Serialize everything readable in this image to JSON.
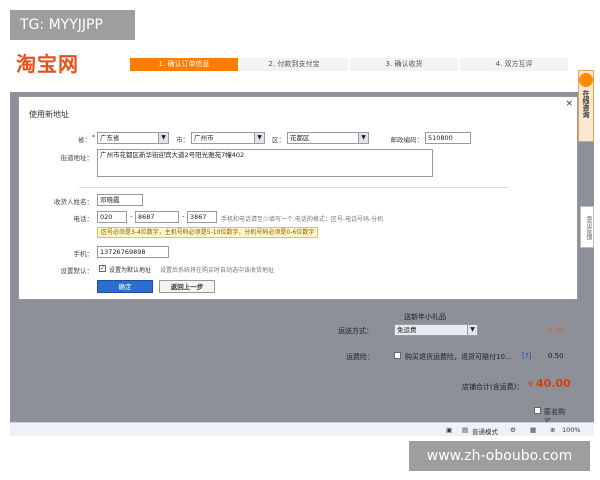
{
  "watermarks": {
    "top": "TG: MYYJJPP",
    "bottom": "www.zh-oboubo.com"
  },
  "header": {
    "logo": "淘宝网",
    "steps": [
      "1. 确认订单信息",
      "2. 付款到支付宝",
      "3. 确认收货",
      "4. 双方互评"
    ],
    "active_step": 0
  },
  "side": {
    "chat": "在线咨询",
    "feedback": "意见反馈"
  },
  "dialog": {
    "title": "使用新地址",
    "close": "×",
    "province_label": "省：",
    "province": "广东省",
    "city_label": "市：",
    "city": "广州市",
    "district_label": "区：",
    "district": "花都区",
    "postcode_label": "邮政编码：",
    "postcode": "510800",
    "street_label": "街道地址：",
    "street": "广州市花都区新华街迎宾大道2号阳光雅苑7幢402",
    "name_label": "收货人姓名：",
    "name": "邓晓霞",
    "phone_label": "电话：",
    "phone_area": "020",
    "phone_num": "8687",
    "phone_ext": "3867",
    "phone_hint": "手机和电话请至少填写一个,电话的格式：区号-电话号码-分机",
    "phone_warn": "区号必须是3-4位数字，主机号码必须是5-10位数字，分机号码必须是0-6位数字",
    "mobile_label": "手机：",
    "mobile": "13726769898",
    "default_label": "设置默认：",
    "default_check": "设置为默认地址",
    "default_hint": "设置后系统将在购买时自动选中该收货地址",
    "ok": "确定",
    "back": "返回上一步"
  },
  "order": {
    "gift_note": "送新年小礼品",
    "ship_label": "运送方式：",
    "ship_value": "免运费",
    "ship_price": "0.00",
    "insure_label": "运费险：",
    "insure_text": "购买退货运费险，退货可赔付10...",
    "insure_link": "[?]",
    "insure_price": "0.50",
    "total_label": "店铺合计(含运费)：",
    "total_currency": "¥",
    "total_value": "40.00",
    "anon_label": "匿名购买"
  },
  "statusbar": {
    "mode": "普通模式",
    "zoom": "100%"
  }
}
